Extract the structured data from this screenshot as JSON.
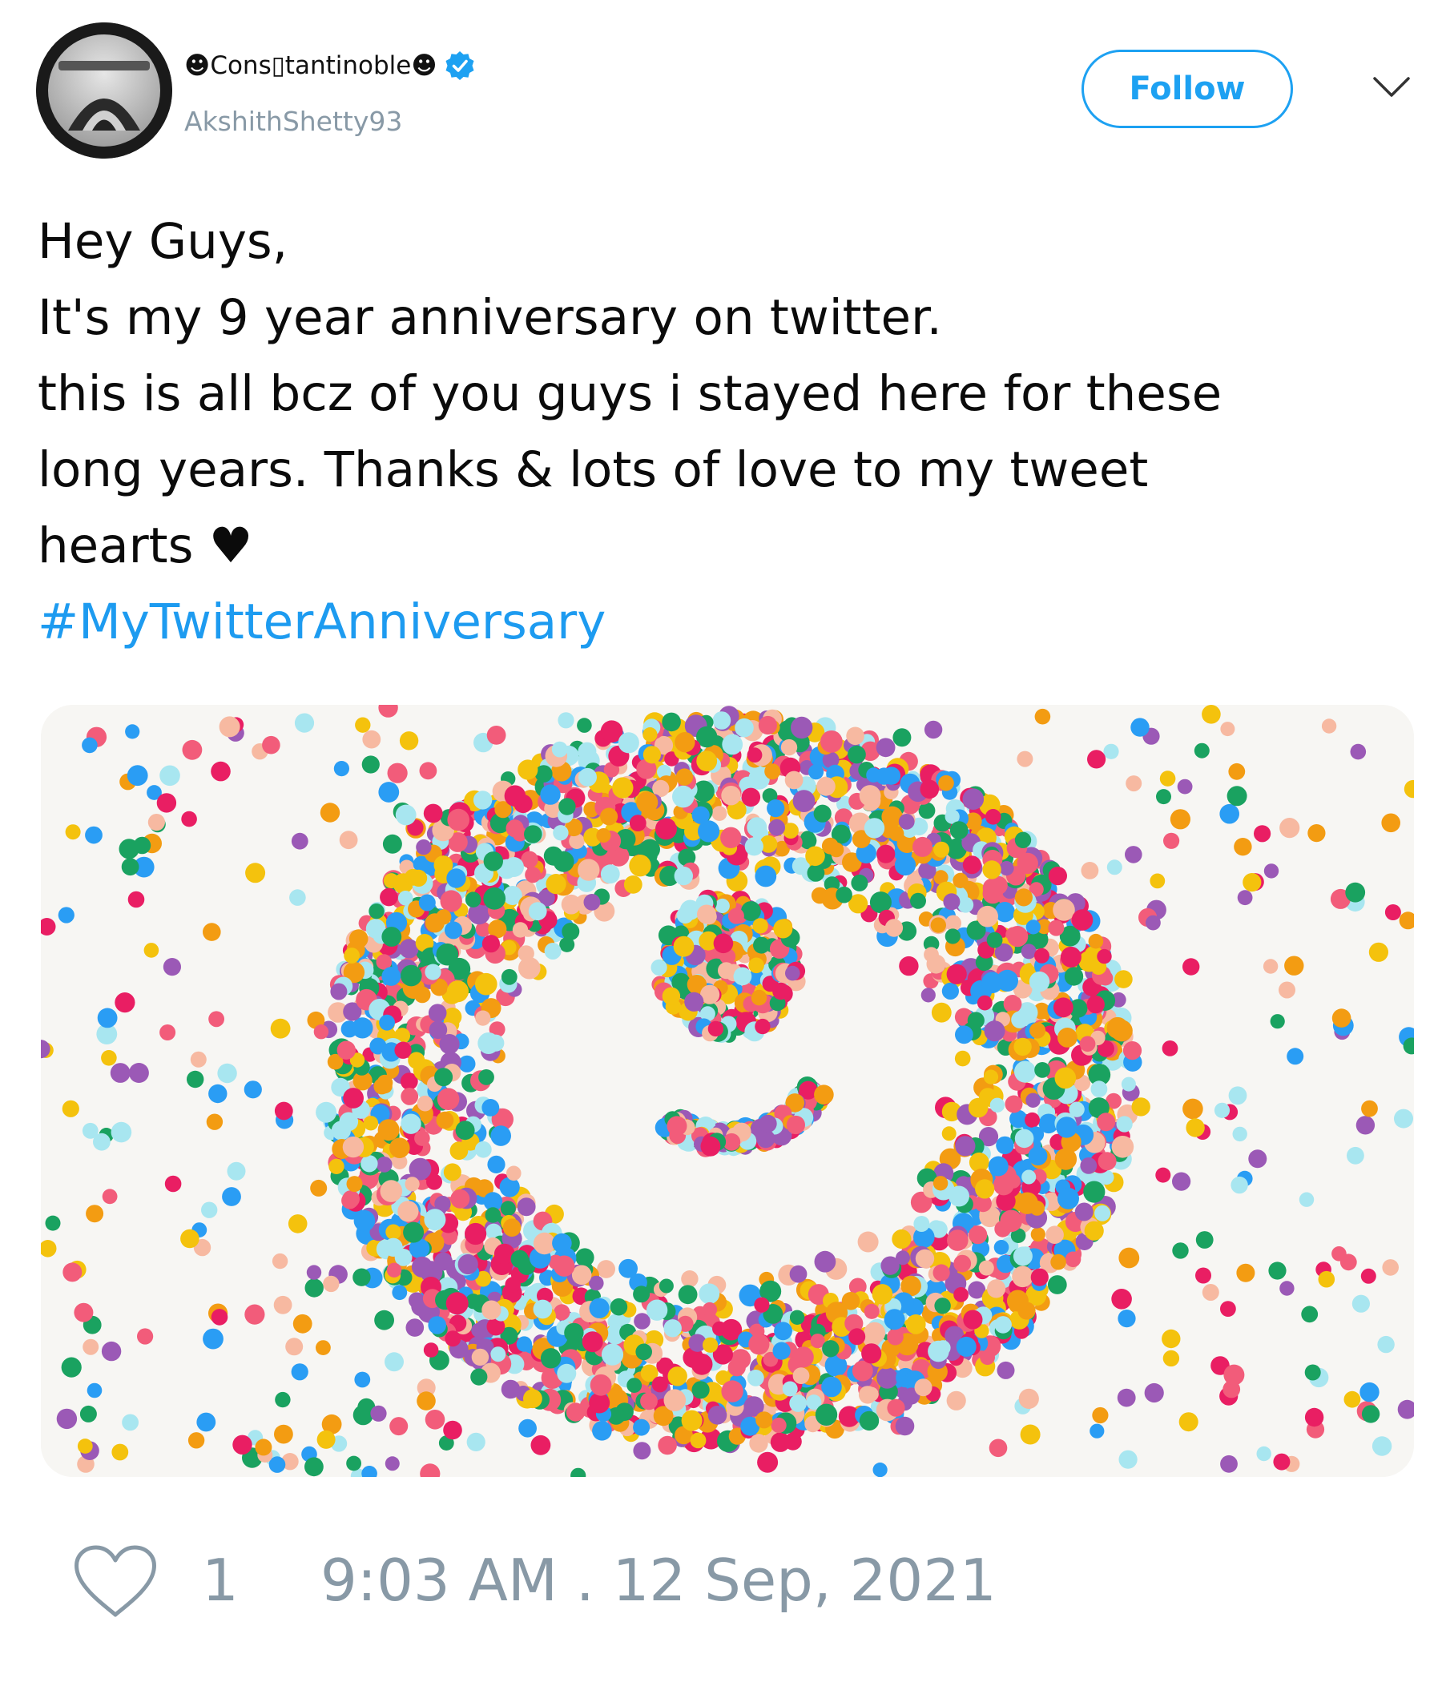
{
  "author": {
    "display_name": "☻Cons▯tantinoble☻",
    "handle": "AkshithShetty93",
    "verified": true,
    "avatar_icon": "profile-avatar"
  },
  "actions": {
    "follow_label": "Follow",
    "menu_icon": "chevron-down-icon"
  },
  "tweet": {
    "lines": [
      "Hey Guys,",
      "It's my 9 year anniversary on twitter.",
      "this is all bcz of you guys i stayed here for these",
      "long years. Thanks & lots of love to my tweet",
      "hearts ♥"
    ],
    "hashtag": "#MyTwitterAnniversary"
  },
  "footer": {
    "like_count": "1",
    "timestamp": "9:03 AM . 12 Sep, 2021",
    "like_icon": "heart-outline-icon"
  },
  "colors": {
    "accent": "#1da1f2",
    "muted": "#8899a6",
    "hashtag": "#1d9bf0",
    "confetti": [
      "#f4c20d",
      "#f25c7a",
      "#1aa260",
      "#2a9df4",
      "#9b59b6",
      "#f39c12",
      "#f7b9a1",
      "#a8e6f0",
      "#e91e63"
    ]
  }
}
